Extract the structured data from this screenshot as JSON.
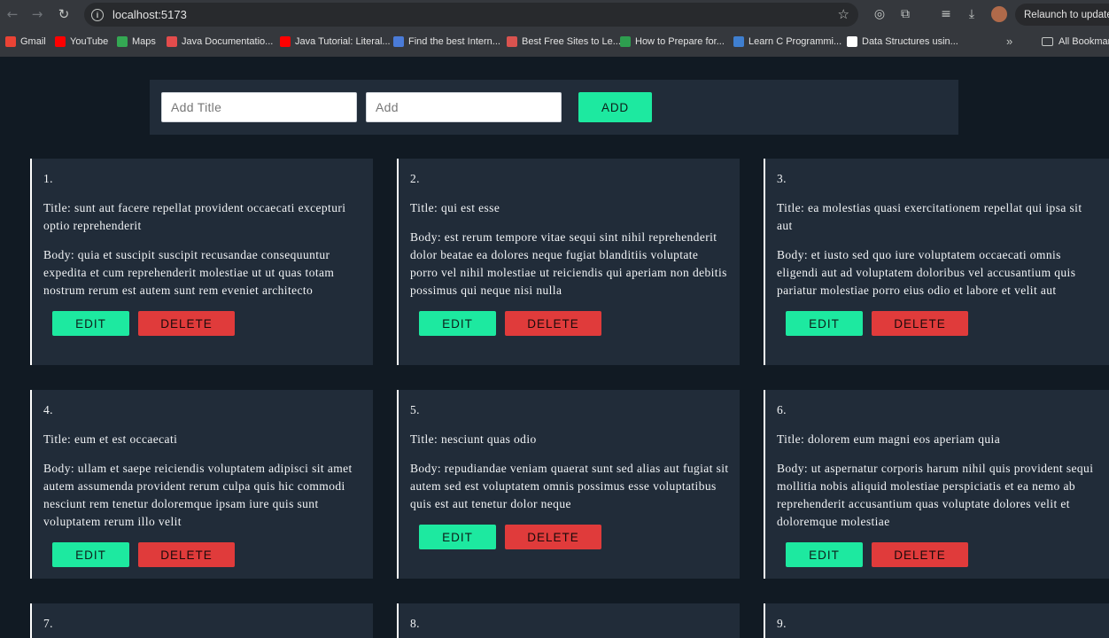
{
  "browser": {
    "url": "localhost:5173",
    "relaunch_label": "Relaunch to update",
    "bookmarks": [
      {
        "label": "Gmail",
        "color": "#ea4335"
      },
      {
        "label": "YouTube",
        "color": "#ff0000"
      },
      {
        "label": "Maps",
        "color": "#34a853"
      },
      {
        "label": "Java Documentatio...",
        "color": "#e34c4c"
      },
      {
        "label": "Java Tutorial: Literal...",
        "color": "#ff0000"
      },
      {
        "label": "Find the best Intern...",
        "color": "#4a7bd8"
      },
      {
        "label": "Best Free Sites to Le...",
        "color": "#d9534f"
      },
      {
        "label": "How to Prepare for...",
        "color": "#2e9e4f"
      },
      {
        "label": "Learn C Programmi...",
        "color": "#3f7fd0"
      },
      {
        "label": "Data Structures usin...",
        "color": "#ffffff"
      }
    ],
    "all_bookmarks_label": "All Bookmarks"
  },
  "form": {
    "title_placeholder": "Add Title",
    "body_placeholder": "Add",
    "add_label": "ADD"
  },
  "buttons": {
    "edit": "EDIT",
    "delete": "DELETE"
  },
  "posts": [
    {
      "num": "1.",
      "title": "Title: sunt aut facere repellat provident occaecati excepturi optio reprehenderit",
      "body": "Body: quia et suscipit suscipit recusandae consequuntur expedita et cum reprehenderit molestiae ut ut quas totam nostrum rerum est autem sunt rem eveniet architecto"
    },
    {
      "num": "2.",
      "title": "Title: qui est esse",
      "body": "Body: est rerum tempore vitae sequi sint nihil reprehenderit dolor beatae ea dolores neque fugiat blanditiis voluptate porro vel nihil molestiae ut reiciendis qui aperiam non debitis possimus qui neque nisi nulla"
    },
    {
      "num": "3.",
      "title": "Title: ea molestias quasi exercitationem repellat qui ipsa sit aut",
      "body": "Body: et iusto sed quo iure voluptatem occaecati omnis eligendi aut ad voluptatem doloribus vel accusantium quis pariatur molestiae porro eius odio et labore et velit aut"
    },
    {
      "num": "4.",
      "title": "Title: eum et est occaecati",
      "body": "Body: ullam et saepe reiciendis voluptatem adipisci sit amet autem assumenda provident rerum culpa quis hic commodi nesciunt rem tenetur doloremque ipsam iure quis sunt voluptatem rerum illo velit"
    },
    {
      "num": "5.",
      "title": "Title: nesciunt quas odio",
      "body": "Body: repudiandae veniam quaerat sunt sed alias aut fugiat sit autem sed est voluptatem omnis possimus esse voluptatibus quis est aut tenetur dolor neque"
    },
    {
      "num": "6.",
      "title": "Title: dolorem eum magni eos aperiam quia",
      "body": "Body: ut aspernatur corporis harum nihil quis provident sequi mollitia nobis aliquid molestiae perspiciatis et ea nemo ab reprehenderit accusantium quas voluptate dolores velit et doloremque molestiae"
    },
    {
      "num": "7."
    },
    {
      "num": "8."
    },
    {
      "num": "9."
    }
  ]
}
